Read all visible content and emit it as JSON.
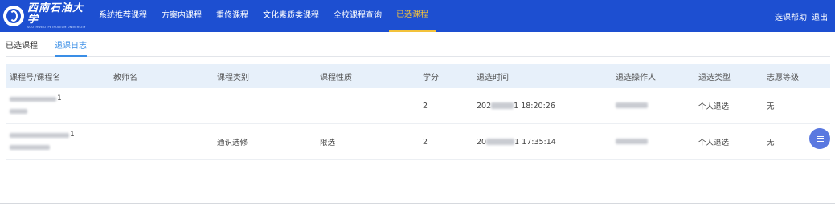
{
  "header": {
    "logo_text": "西南石油大学",
    "logo_subtext": "SOUTHWEST PETROLEUM UNIVERSITY",
    "nav": [
      {
        "label": "系统推荐课程",
        "active": false
      },
      {
        "label": "方案内课程",
        "active": false
      },
      {
        "label": "重修课程",
        "active": false
      },
      {
        "label": "文化素质类课程",
        "active": false
      },
      {
        "label": "全校课程查询",
        "active": false
      },
      {
        "label": "已选课程",
        "active": true
      }
    ],
    "help_label": "选课帮助",
    "logout_label": "退出"
  },
  "tabs": [
    {
      "label": "已选课程",
      "active": false
    },
    {
      "label": "退课日志",
      "active": true
    }
  ],
  "table": {
    "headers": [
      "课程号/课程名",
      "教师名",
      "课程类别",
      "课程性质",
      "学分",
      "退选时间",
      "退选操作人",
      "退选类型",
      "志愿等级"
    ],
    "rows": [
      {
        "course_code": "1",
        "course_name": "",
        "teacher": "",
        "category": "",
        "nature": "",
        "credit": "2",
        "time_prefix": "202",
        "time_suffix": "1 18:20:26",
        "operator": "",
        "type": "个人退选",
        "level": "无"
      },
      {
        "course_code": "1",
        "course_name": "",
        "teacher": "",
        "category": "通识选修",
        "nature": "限选",
        "credit": "2",
        "time_prefix": "20",
        "time_suffix": "1 17:35:14",
        "operator": "",
        "type": "个人退选",
        "level": "无"
      }
    ]
  },
  "colors": {
    "header_bg": "#1d4fd1",
    "active_nav": "#f3c23a",
    "active_tab": "#3a8ee6",
    "table_header_bg": "#e7f0fa",
    "fab_bg": "#5a78e0"
  },
  "icons": {
    "logo": "university-emblem-icon",
    "fab": "menu-icon"
  }
}
